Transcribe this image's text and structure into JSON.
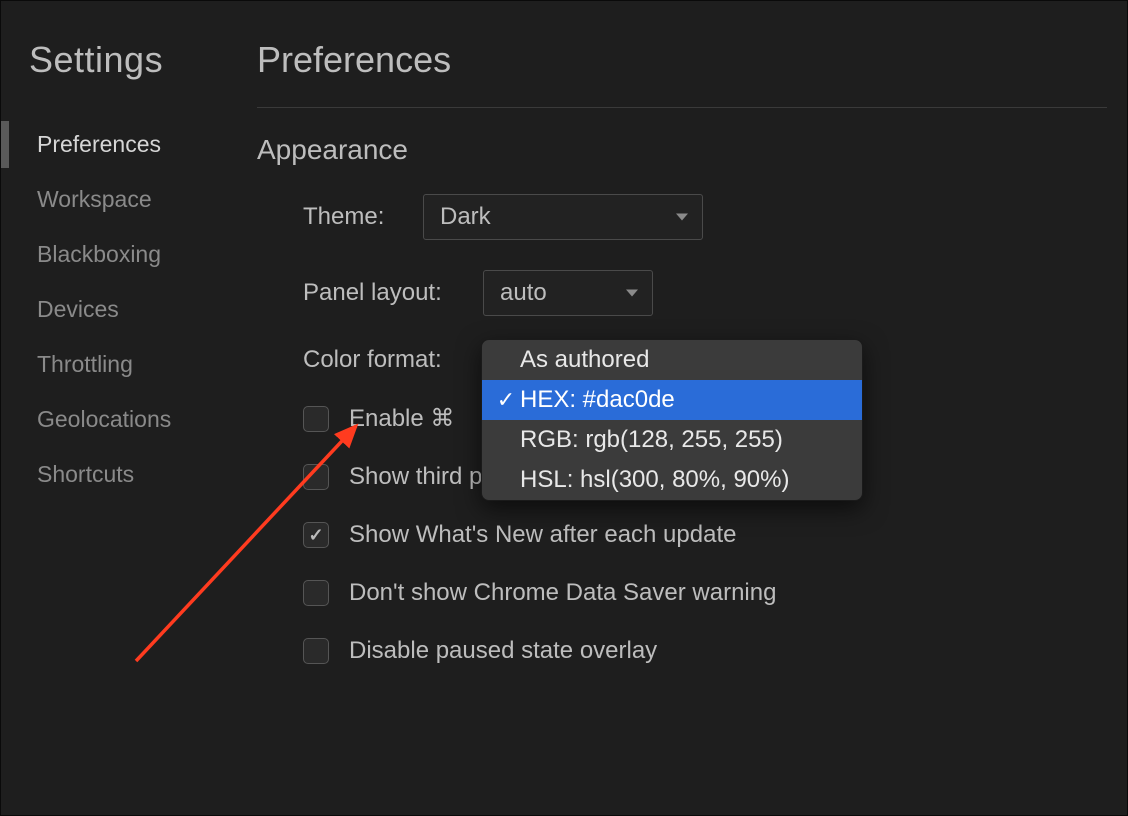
{
  "sidebar": {
    "title": "Settings",
    "items": [
      {
        "label": "Preferences",
        "active": true
      },
      {
        "label": "Workspace",
        "active": false
      },
      {
        "label": "Blackboxing",
        "active": false
      },
      {
        "label": "Devices",
        "active": false
      },
      {
        "label": "Throttling",
        "active": false
      },
      {
        "label": "Geolocations",
        "active": false
      },
      {
        "label": "Shortcuts",
        "active": false
      }
    ]
  },
  "main": {
    "title": "Preferences",
    "section": "Appearance",
    "theme": {
      "label": "Theme:",
      "value": "Dark"
    },
    "panel_layout": {
      "label": "Panel layout:",
      "value": "auto"
    },
    "color_format": {
      "label": "Color format:",
      "options": [
        {
          "label": "As authored",
          "selected": false
        },
        {
          "label": "HEX: #dac0de",
          "selected": true
        },
        {
          "label": "RGB: rgb(128, 255, 255)",
          "selected": false
        },
        {
          "label": "HSL: hsl(300, 80%, 90%)",
          "selected": false
        }
      ]
    },
    "checks": [
      {
        "label": "Enable ⌘",
        "checked": false
      },
      {
        "label": "Show third party URL badges",
        "checked": false
      },
      {
        "label": "Show What's New after each update",
        "checked": true
      },
      {
        "label": "Don't show Chrome Data Saver warning",
        "checked": false
      },
      {
        "label": "Disable paused state overlay",
        "checked": false
      }
    ]
  }
}
